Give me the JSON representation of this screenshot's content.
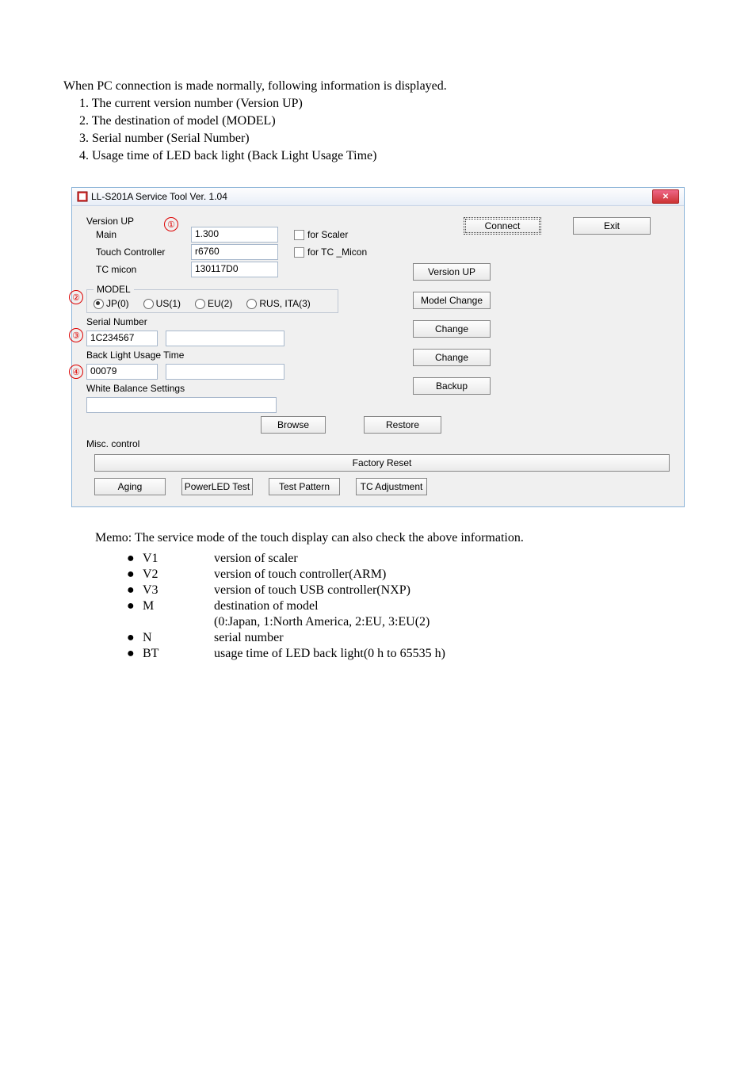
{
  "intro": "When PC connection is made normally, following information is displayed.",
  "list": {
    "i1": "1. The current version number (Version UP)",
    "i2": "2. The destination of model (MODEL)",
    "i3": "3. Serial number (Serial Number)",
    "i4": "4. Usage time of LED back light (Back Light Usage Time)"
  },
  "window": {
    "title": "LL-S201A Service Tool  Ver. 1.04",
    "connect": "Connect",
    "exit": "Exit",
    "version_up_label": "Version UP",
    "main_label": "Main",
    "main_value": "1.300",
    "tc_label": "Touch Controller",
    "tc_value": "r6760",
    "tcm_label": "TC micon",
    "tcm_value": "130117D0",
    "for_scaler": "for Scaler",
    "for_tc_micon": "for TC _Micon",
    "version_up_btn": "Version UP",
    "model_legend": "MODEL",
    "jp": "JP(0)",
    "us": "US(1)",
    "eu": "EU(2)",
    "rus": "RUS, ITA(3)",
    "model_change": "Model Change",
    "serial_label": "Serial Number",
    "serial_value": "1C234567",
    "change": "Change",
    "blut_label": "Back Light Usage Time",
    "blut_value": "00079",
    "wb_label": "White Balance Settings",
    "backup": "Backup",
    "browse": "Browse",
    "restore": "Restore",
    "misc_label": "Misc. control",
    "factory_reset": "Factory Reset",
    "aging": "Aging",
    "powerled": "PowerLED Test",
    "testpattern": "Test Pattern",
    "tcadj": "TC Adjustment"
  },
  "annot": {
    "a1": "①",
    "a2": "②",
    "a3": "③",
    "a4": "④"
  },
  "memo": "Memo: The service mode of the touch display can also check the above information.",
  "defs": {
    "v1": {
      "k": "V1",
      "d": "version of scaler"
    },
    "v2": {
      "k": "V2",
      "d": "version of touch controller(ARM)"
    },
    "v3": {
      "k": "V3",
      "d": "version of touch USB controller(NXP)"
    },
    "m": {
      "k": "M",
      "d": "destination of model"
    },
    "m2": {
      "k": "",
      "d": "(0:Japan, 1:North America, 2:EU, 3:EU(2)"
    },
    "n": {
      "k": "N",
      "d": "serial number"
    },
    "bt": {
      "k": "BT",
      "d": "usage time of LED back light(0 h to 65535 h)"
    }
  }
}
